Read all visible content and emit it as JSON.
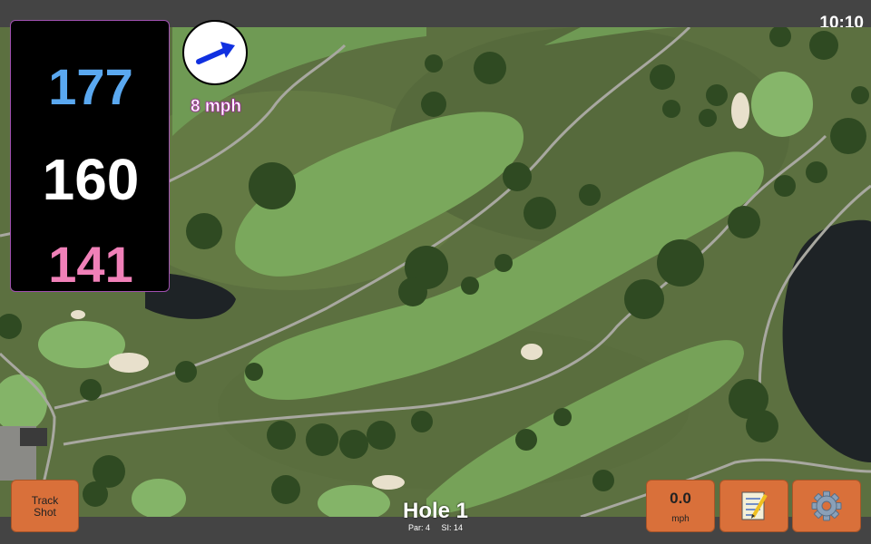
{
  "status_bar": {
    "time": "10:10"
  },
  "distances": {
    "back": "177",
    "middle": "160",
    "front": "141"
  },
  "wind": {
    "speed": "8 mph",
    "direction_icon": "arrow-icon"
  },
  "hole": {
    "title": "Hole 1",
    "par": "Par: 4",
    "stroke_index": "SI: 14"
  },
  "buttons": {
    "track_shot_line1": "Track",
    "track_shot_line2": "Shot",
    "wind_value": "0.0",
    "wind_unit": "mph",
    "notes_icon": "notepad-icon",
    "settings_icon": "gear-icon"
  },
  "colors": {
    "back_distance": "#5aa8f0",
    "middle_distance": "#ffffff",
    "front_distance": "#f080b8",
    "button": "#d9703a",
    "accent": "#c058c8"
  }
}
